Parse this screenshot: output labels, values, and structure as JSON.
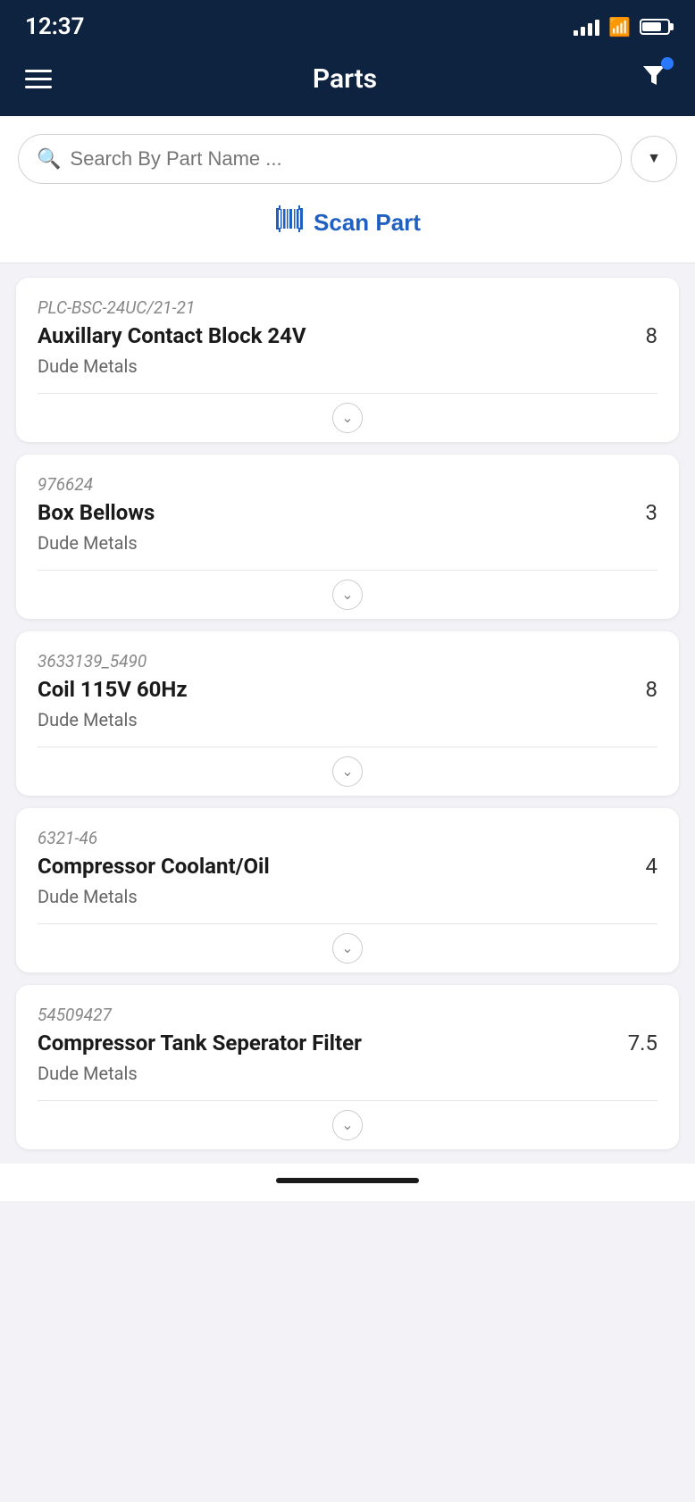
{
  "statusBar": {
    "time": "12:37"
  },
  "header": {
    "title": "Parts",
    "hamburger_label": "Menu",
    "filter_label": "Filter"
  },
  "search": {
    "placeholder": "Search By Part Name ...",
    "dropdown_label": "▼"
  },
  "scanPart": {
    "label": "Scan Part"
  },
  "parts": [
    {
      "sku": "PLC-BSC-24UC/21-21",
      "name": "Auxillary Contact Block 24V",
      "quantity": "8",
      "vendor": "Dude Metals"
    },
    {
      "sku": "976624",
      "name": "Box Bellows",
      "quantity": "3",
      "vendor": "Dude Metals"
    },
    {
      "sku": "3633139_5490",
      "name": "Coil 115V 60Hz",
      "quantity": "8",
      "vendor": "Dude Metals"
    },
    {
      "sku": "6321-46",
      "name": "Compressor Coolant/Oil",
      "quantity": "4",
      "vendor": "Dude Metals"
    },
    {
      "sku": "54509427",
      "name": "Compressor Tank Seperator Filter",
      "quantity": "7.5",
      "vendor": "Dude Metals"
    }
  ],
  "colors": {
    "header_bg": "#0d2340",
    "accent_blue": "#2060c0",
    "filter_dot": "#2979ff"
  }
}
